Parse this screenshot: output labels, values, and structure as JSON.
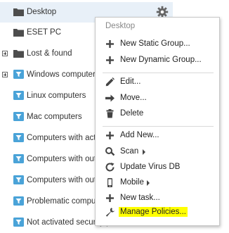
{
  "tree": {
    "items": [
      {
        "label": "Desktop"
      },
      {
        "label": "ESET PC"
      },
      {
        "label": "Lost & found"
      },
      {
        "label": "Windows computers"
      },
      {
        "label": "Linux computers"
      },
      {
        "label": "Mac computers"
      },
      {
        "label": "Computers with active threats"
      },
      {
        "label": "Computers with outdated modules"
      },
      {
        "label": "Computers with outdated operating system"
      },
      {
        "label": "Problematic computers"
      },
      {
        "label": "Not activated security product"
      }
    ]
  },
  "menu": {
    "title": "Desktop",
    "items": [
      {
        "label": "New Static Group...",
        "icon": "plus-icon"
      },
      {
        "label": "New Dynamic Group...",
        "icon": "plus-icon"
      },
      {
        "label": "Edit...",
        "icon": "pencil-icon"
      },
      {
        "label": "Move...",
        "icon": "arrow-right-icon"
      },
      {
        "label": "Delete",
        "icon": "trash-icon"
      },
      {
        "label": "Add New...",
        "icon": "plus-icon"
      },
      {
        "label": "Scan",
        "icon": "magnifier-icon"
      },
      {
        "label": "Update Virus DB",
        "icon": "refresh-icon"
      },
      {
        "label": "Mobile",
        "icon": "mobile-icon"
      },
      {
        "label": "New task...",
        "icon": "plus-icon"
      },
      {
        "label": "Manage Policies...",
        "icon": "wrench-icon"
      }
    ]
  },
  "colors": {
    "selection": "#e8f0f8",
    "filter_icon": "#4aa3d8",
    "highlight": "#ffff00"
  }
}
